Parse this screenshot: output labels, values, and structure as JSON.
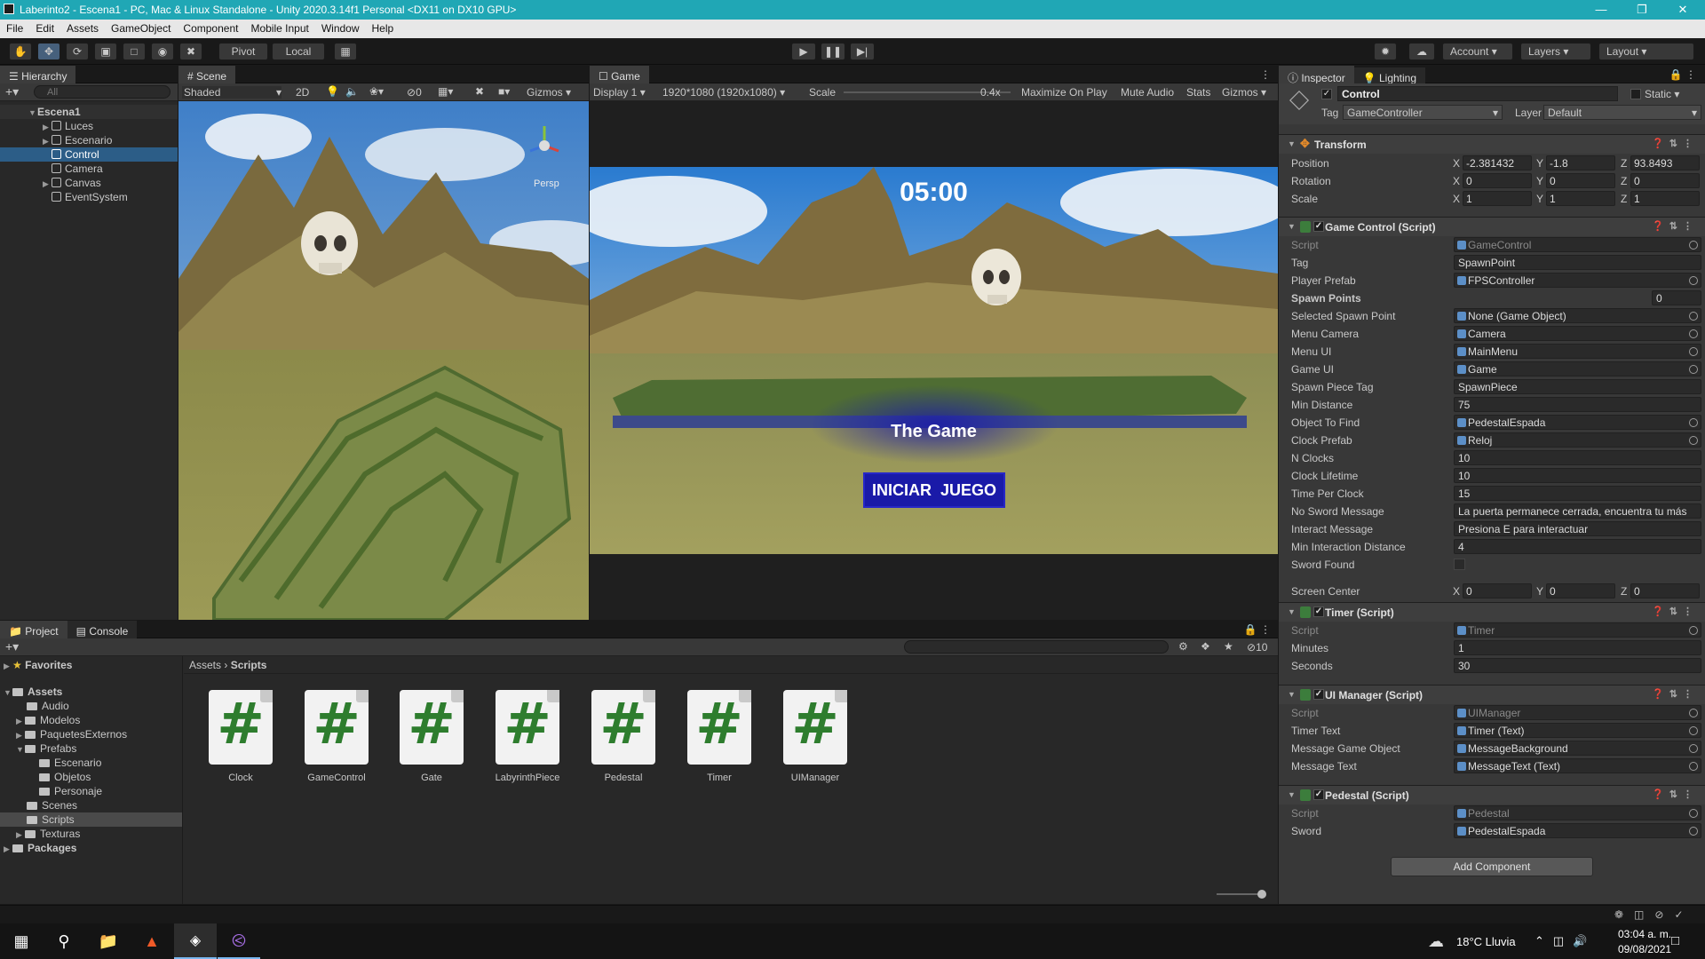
{
  "window": {
    "title": "Laberinto2 - Escena1 - PC, Mac & Linux Standalone - Unity 2020.3.14f1 Personal <DX11 on DX10 GPU>"
  },
  "menu": [
    "File",
    "Edit",
    "Assets",
    "GameObject",
    "Component",
    "Mobile Input",
    "Window",
    "Help"
  ],
  "toolbar": {
    "pivot": "Pivot",
    "local": "Local",
    "account": "Account",
    "layers": "Layers",
    "layout": "Layout"
  },
  "hierarchy": {
    "tab": "Hierarchy",
    "search_placeholder": "All",
    "scene": "Escena1",
    "items": [
      "Luces",
      "Escenario",
      "Control",
      "Camera",
      "Canvas",
      "EventSystem"
    ]
  },
  "scene": {
    "tab": "Scene",
    "shading": "Shaded",
    "mode2d": "2D",
    "hidden_count": "0",
    "gizmos": "Gizmos",
    "persp": "Persp"
  },
  "game": {
    "tab": "Game",
    "display": "Display 1",
    "resolution": "1920*1080 (1920x1080)",
    "scale_label": "Scale",
    "scale_value": "0.4x",
    "maximize": "Maximize On Play",
    "mute": "Mute Audio",
    "stats": "Stats",
    "gizmos": "Gizmos",
    "timer": "05:00",
    "title": "The Game",
    "button": "INICIAR  JUEGO"
  },
  "inspector": {
    "tabs": [
      "Inspector",
      "Lighting"
    ],
    "object_name": "Control",
    "static": "Static",
    "tag_label": "Tag",
    "tag": "GameController",
    "layer_label": "Layer",
    "layer": "Default",
    "transform": {
      "title": "Transform",
      "position": {
        "label": "Position",
        "x": "-2.381432",
        "y": "-1.8",
        "z": "93.8493"
      },
      "rotation": {
        "label": "Rotation",
        "x": "0",
        "y": "0",
        "z": "0"
      },
      "scale": {
        "label": "Scale",
        "x": "1",
        "y": "1",
        "z": "1"
      }
    },
    "game_control": {
      "title": "Game Control (Script)",
      "rows": [
        {
          "label": "Script",
          "value": "GameControl"
        },
        {
          "label": "Tag",
          "value": "SpawnPoint"
        },
        {
          "label": "Player Prefab",
          "value": "FPSController"
        },
        {
          "label": "Spawn Points",
          "value": "0"
        },
        {
          "label": "Selected Spawn Point",
          "value": "None (Game Object)"
        },
        {
          "label": "Menu Camera",
          "value": "Camera"
        },
        {
          "label": "Menu UI",
          "value": "MainMenu"
        },
        {
          "label": "Game UI",
          "value": "Game"
        },
        {
          "label": "Spawn Piece Tag",
          "value": "SpawnPiece"
        },
        {
          "label": "Min Distance",
          "value": "75"
        },
        {
          "label": "Object To Find",
          "value": "PedestalEspada"
        },
        {
          "label": "Clock Prefab",
          "value": "Reloj"
        },
        {
          "label": "N Clocks",
          "value": "10"
        },
        {
          "label": "Clock Lifetime",
          "value": "10"
        },
        {
          "label": "Time Per Clock",
          "value": "15"
        },
        {
          "label": "No Sword Message",
          "value": "La puerta permanece cerrada, encuentra tu más"
        },
        {
          "label": "Interact Message",
          "value": "Presiona E para interactuar"
        },
        {
          "label": "Min Interaction Distance",
          "value": "4"
        },
        {
          "label": "Sword Found",
          "value": ""
        }
      ],
      "screen_center": {
        "label": "Screen Center",
        "x": "0",
        "y": "0",
        "z": "0"
      }
    },
    "timer": {
      "title": "Timer (Script)",
      "rows": [
        {
          "label": "Script",
          "value": "Timer"
        },
        {
          "label": "Minutes",
          "value": "1"
        },
        {
          "label": "Seconds",
          "value": "30"
        }
      ]
    },
    "ui_manager": {
      "title": "UI Manager (Script)",
      "rows": [
        {
          "label": "Script",
          "value": "UIManager"
        },
        {
          "label": "Timer Text",
          "value": "Timer (Text)"
        },
        {
          "label": "Message Game Object",
          "value": "MessageBackground"
        },
        {
          "label": "Message Text",
          "value": "MessageText (Text)"
        }
      ]
    },
    "pedestal": {
      "title": "Pedestal (Script)",
      "rows": [
        {
          "label": "Script",
          "value": "Pedestal"
        },
        {
          "label": "Sword",
          "value": "PedestalEspada"
        }
      ]
    },
    "add_component": "Add Component"
  },
  "project": {
    "tabs": [
      "Project",
      "Console"
    ],
    "hidden_count": "10",
    "breadcrumb": [
      "Assets",
      "Scripts"
    ],
    "favorites": "Favorites",
    "tree": [
      "Assets",
      "Audio",
      "Modelos",
      "PaquetesExternos",
      "Prefabs",
      "Escenario",
      "Objetos",
      "Personaje",
      "Scenes",
      "Scripts",
      "Texturas",
      "Packages"
    ],
    "assets": [
      "Clock",
      "GameControl",
      "Gate",
      "LabyrinthPiece",
      "Pedestal",
      "Timer",
      "UIManager"
    ]
  },
  "taskbar": {
    "weather": "18°C  Lluvia",
    "time": "03:04 a. m.",
    "date": "09/08/2021"
  },
  "colors": {
    "accent": "#2c5d87",
    "title_bar": "#20a7b5",
    "game_button": "#1a1aa8",
    "script_icon": "#2e7d2e"
  }
}
